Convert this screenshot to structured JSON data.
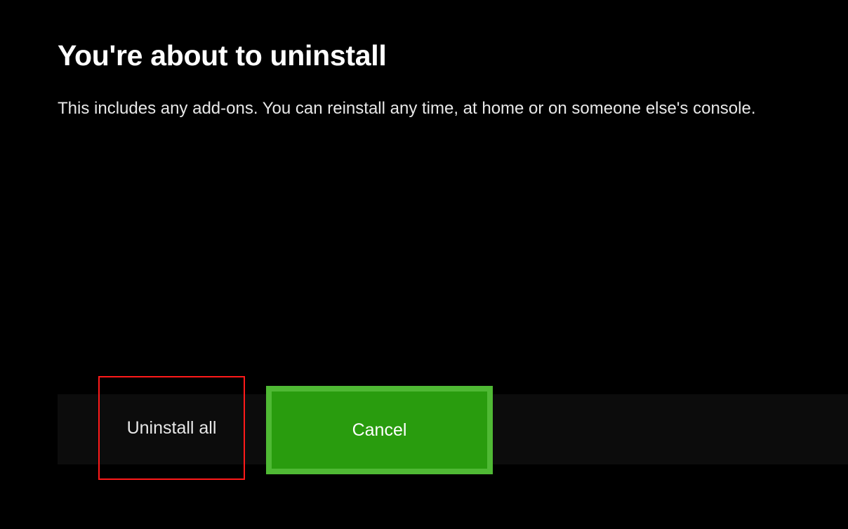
{
  "dialog": {
    "title": "You're about to uninstall",
    "description": "This includes any add-ons. You can reinstall any time, at home or on someone else's console."
  },
  "buttons": {
    "uninstall_label": "Uninstall all",
    "cancel_label": "Cancel"
  }
}
